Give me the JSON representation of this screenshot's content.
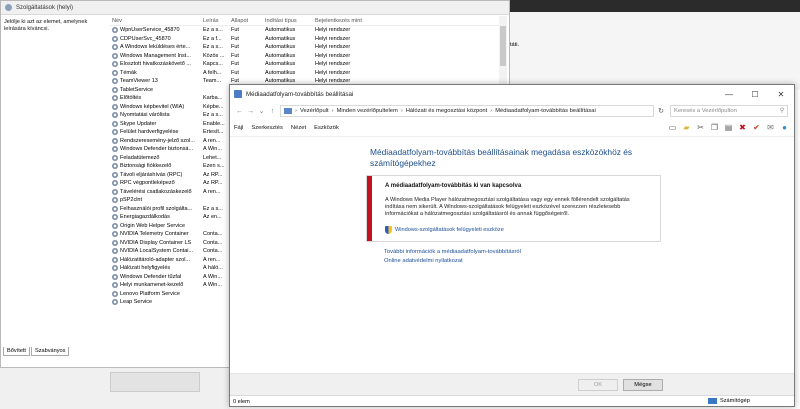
{
  "services": {
    "title": "Szolgáltatások (helyi)",
    "left_description": "Jelölje ki azt az elemet, amelynek leírására kíváncsi.",
    "columns": [
      "Név",
      "Leírás",
      "Állapot",
      "Indítási típus",
      "Bejelentkezés mint"
    ],
    "rows": [
      [
        "WpnUserService_45870",
        "Ez a s...",
        "Fut",
        "Automatikus",
        "Helyi rendszer"
      ],
      [
        "CDPUserSvc_45870",
        "Ez a f...",
        "Fut",
        "Automatikus",
        "Helyi rendszer"
      ],
      [
        "A Windows leküldéses érte...",
        "Ez a s...",
        "Fut",
        "Automatikus",
        "Helyi rendszer"
      ],
      [
        "Windows Management Inst...",
        "Közös ...",
        "Fut",
        "Automatikus",
        "Helyi rendszer"
      ],
      [
        "Elosztott hivatkozáskövető ...",
        "Kapcs...",
        "Fut",
        "Automatikus",
        "Helyi rendszer"
      ],
      [
        "Témák",
        "A felh...",
        "Fut",
        "Automatikus",
        "Helyi rendszer"
      ],
      [
        "TeamViewer 13",
        "Team...",
        "Fut",
        "Automatikus",
        "Helyi rendszer"
      ],
      [
        "TabletService",
        "",
        "",
        "",
        ""
      ],
      [
        "Előtöltés",
        "Karba...",
        "",
        "",
        ""
      ],
      [
        "Windows képbevitel (WIA)",
        "Képbe...",
        "",
        "",
        ""
      ],
      [
        "Nyomtatási várólista",
        "Ez a s...",
        "",
        "",
        ""
      ],
      [
        "Skype Updater",
        "Enable...",
        "",
        "",
        ""
      ],
      [
        "Felület hardverfigyelése",
        "Értesít...",
        "",
        "",
        ""
      ],
      [
        "Rendszeresemény-jelző szol...",
        "A ren...",
        "",
        "",
        ""
      ],
      [
        "Windows Defender biztonsá...",
        "A Win...",
        "",
        "",
        ""
      ],
      [
        "Feladatütemező",
        "Lehet...",
        "",
        "",
        ""
      ],
      [
        "Biztonsági fiókkezelő",
        "Ezen s...",
        "",
        "",
        ""
      ],
      [
        "Távoli eljáráshívás (RPC)",
        "Az RP...",
        "",
        "",
        ""
      ],
      [
        "RPC végpontleképező",
        "Az RP...",
        "",
        "",
        ""
      ],
      [
        "Távelérési csatlakozáskezelő",
        "A ren...",
        "",
        "",
        ""
      ],
      [
        "pSP2clnt",
        "",
        "",
        "",
        ""
      ],
      [
        "Felhasználói profil szolgálta...",
        "Ez a s...",
        "",
        "",
        ""
      ],
      [
        "Energiagazdálkodás",
        "Az en...",
        "",
        "",
        ""
      ],
      [
        "Origin Web Helper Service",
        "",
        "",
        "",
        ""
      ],
      [
        "NVIDIA Telemetry Container",
        "Conta...",
        "",
        "",
        ""
      ],
      [
        "NVIDIA Display Container LS",
        "Conta...",
        "",
        "",
        ""
      ],
      [
        "NVIDIA LocalSystem Contai...",
        "Conta...",
        "",
        "",
        ""
      ],
      [
        "Hálózatitároló-adapter szol...",
        "A ren...",
        "",
        "",
        ""
      ],
      [
        "Hálózati helyfigyelés",
        "A háló...",
        "",
        "",
        ""
      ],
      [
        "Windows Defender tűzfal",
        "A Win...",
        "",
        "",
        ""
      ],
      [
        "Helyi munkamenet-kezelő",
        "A Win...",
        "",
        "",
        ""
      ],
      [
        "Lenovo Platform Service",
        "",
        "",
        "",
        ""
      ],
      [
        "Leap Service",
        "",
        "",
        "",
        ""
      ]
    ],
    "tabs": [
      "Bővített",
      "Szabványos"
    ]
  },
  "background_right_text": "táti.",
  "media": {
    "title": "Médiaadatfolyam-továbbítás beállításai",
    "window_buttons": {
      "minimize": "—",
      "maximize": "☐",
      "close": "✕"
    },
    "nav": {
      "back": "←",
      "forward": "→",
      "up": "↑",
      "recent": "⌄"
    },
    "breadcrumbs": [
      "Vezérlőpult",
      "Minden vezérlőpultelem",
      "Hálózati és megosztási központ",
      "Médiaadatfolyam-továbbítás beállításai"
    ],
    "search_placeholder": "Keresés a Vezérlőpulton",
    "menu": [
      "Fájl",
      "Szerkesztés",
      "Nézet",
      "Eszközök"
    ],
    "heading": "Médiaadatfolyam-továbbítás beállításainak megadása eszközökhöz és számítógépekhez",
    "error": {
      "title": "A médiaadatfolyam-továbbítás ki van kapcsolva",
      "text": "A Windows Media Player hálózatmegosztási szolgáltatása vagy egy ennek föllérendelt szolgáltatás indítása nem sikerült. A Windows-szolgáltatások felügyeleti eszközével szerezzen részletesebb információkat a hálózatmegosztási szolgáltatásról és annak függőségeiről.",
      "link": "Windows-szolgáltatások felügyeleti eszköze"
    },
    "links": [
      "További információk a médiaadatfolyam-továbbításról",
      "Online adatvédelmi nyilatkozat"
    ],
    "buttons": {
      "ok": "OK",
      "cancel": "Mégse"
    },
    "status": {
      "items": "0 elem",
      "location": "Számítógép"
    }
  },
  "colors": {
    "accent_red": "#c0121f",
    "link_blue": "#1a4f99",
    "heading_blue": "#1e4e8c"
  }
}
